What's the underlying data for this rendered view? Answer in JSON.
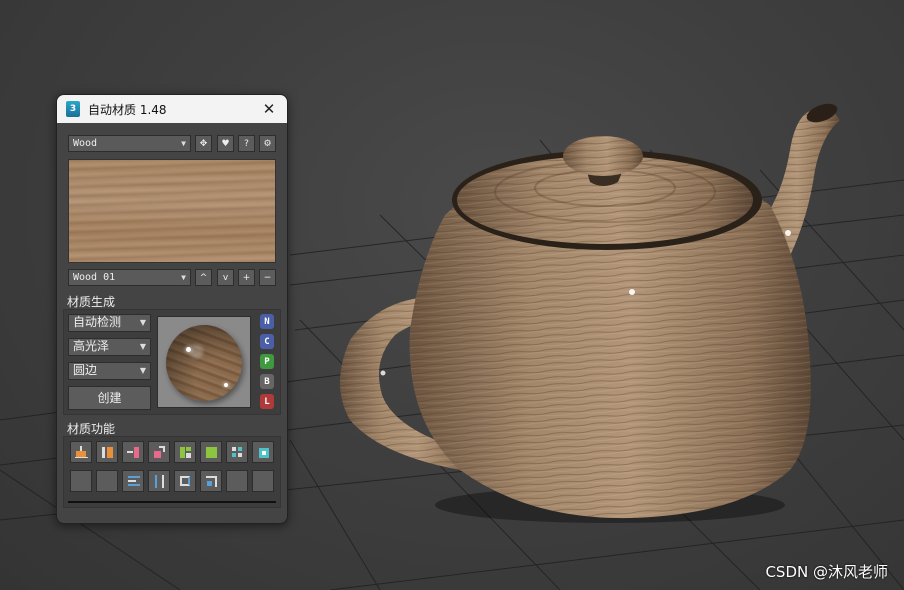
{
  "window": {
    "app_icon": "3ds-max-icon",
    "title": "自动材质 1.48"
  },
  "top_row": {
    "material_select": "Wood",
    "buttons": [
      "move-icon",
      "heart-icon",
      "?",
      "gear-icon"
    ]
  },
  "sub_row": {
    "variant_select": "Wood 01",
    "buttons": [
      "^",
      "v",
      "+",
      "−"
    ]
  },
  "generate": {
    "label": "材质生成",
    "detect_select": "自动检测",
    "gloss_select": "高光泽",
    "edge_select": "圆边",
    "create_button": "创建",
    "letter_buttons": [
      {
        "label": "N",
        "color": "#4a5fa8"
      },
      {
        "label": "C",
        "color": "#4a5fa8"
      },
      {
        "label": "P",
        "color": "#3f9a3f"
      },
      {
        "label": "B",
        "color": "#666666"
      },
      {
        "label": "L",
        "color": "#b03a3a"
      }
    ]
  },
  "functions": {
    "label": "材质功能",
    "row1_icons": [
      "align-bottom-icon",
      "split-orange-icon",
      "pink-bars-icon",
      "stack-pink-icon",
      "green-blocks-icon",
      "green-square-icon",
      "grid-icon",
      "teal-box-icon"
    ],
    "row2_icons": [
      "empty-1",
      "empty-2",
      "align-lines-icon",
      "parallel-icon",
      "loop-icon",
      "corner-icon",
      "empty-3",
      "empty-4"
    ]
  },
  "watermark": "CSDN @沐风老师"
}
